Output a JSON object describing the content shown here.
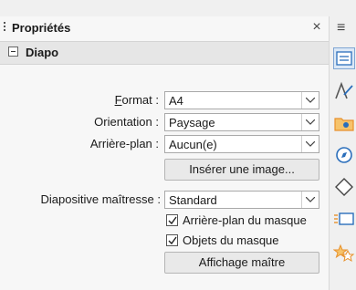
{
  "panel": {
    "title": "Propriétés",
    "close_glyph": "×",
    "section": "Diapo"
  },
  "fields": {
    "format": {
      "label_accel": "F",
      "label_rest": "ormat :",
      "value": "A4"
    },
    "orientation": {
      "label": "Orientation :",
      "value": "Paysage"
    },
    "background": {
      "label": "Arrière-plan :",
      "value": "Aucun(e)"
    },
    "insert_image": "Insérer une image...",
    "master": {
      "label": "Diapositive maîtresse :",
      "value": "Standard"
    },
    "master_background": {
      "label": "Arrière-plan du masque",
      "checked": true
    },
    "master_objects": {
      "label": "Objets du masque",
      "checked": true
    },
    "master_view": "Affichage maître"
  },
  "sidebar": {
    "menu_glyph": "≡",
    "icons": [
      "properties-icon",
      "styles-icon",
      "gallery-icon",
      "navigator-icon",
      "shapes-icon",
      "slide-transition-icon",
      "animation-icon"
    ]
  },
  "colors": {
    "accent": "#2a6ebb",
    "orange": "#e8912c",
    "active_bg": "#dbe8f6"
  }
}
